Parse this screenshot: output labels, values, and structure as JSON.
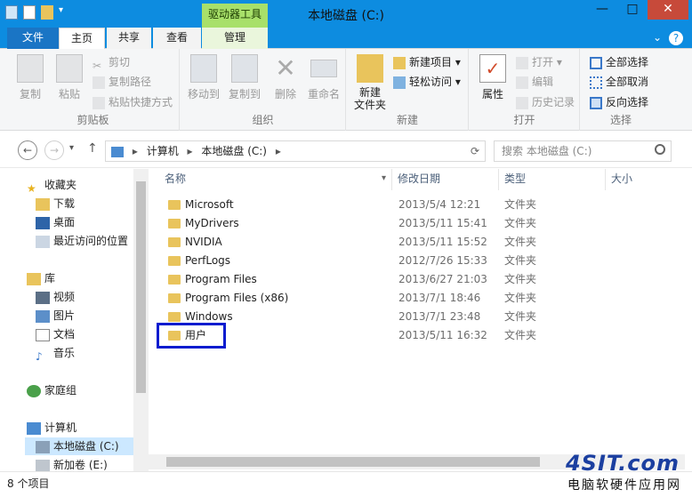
{
  "window": {
    "title": "本地磁盘 (C:)",
    "context_tool_label": "驱动器工具",
    "minimize": "—",
    "maximize": "□",
    "close": "✕"
  },
  "tabs": {
    "file": "文件",
    "home": "主页",
    "share": "共享",
    "view": "查看",
    "manage": "管理",
    "collapse": "⌄",
    "help": "?"
  },
  "ribbon": {
    "clipboard": {
      "label": "剪贴板",
      "copy": "复制",
      "paste": "粘贴",
      "cut": "剪切",
      "copy_path": "复制路径",
      "paste_shortcut": "粘贴快捷方式"
    },
    "organize": {
      "label": "组织",
      "move_to": "移动到",
      "copy_to": "复制到",
      "delete": "删除",
      "rename": "重命名"
    },
    "new": {
      "label": "新建",
      "new_folder": "新建\n文件夹",
      "new_item": "新建项目 ▾",
      "easy_access": "轻松访问 ▾"
    },
    "open": {
      "label": "打开",
      "properties": "属性",
      "open": "打开 ▾",
      "edit": "编辑",
      "history": "历史记录"
    },
    "select": {
      "label": "选择",
      "select_all": "全部选择",
      "select_none": "全部取消",
      "invert": "反向选择"
    }
  },
  "address": {
    "back": "←",
    "forward": "→",
    "recent": "▾",
    "up": "↑",
    "segments": [
      "计算机",
      "本地磁盘 (C:)"
    ],
    "sep": "▸",
    "refresh": "⟳",
    "search_placeholder": "搜索 本地磁盘 (C:)"
  },
  "nav": {
    "favorites": "收藏夹",
    "downloads": "下载",
    "desktop": "桌面",
    "recent": "最近访问的位置",
    "libraries": "库",
    "videos": "视频",
    "pictures": "图片",
    "documents": "文档",
    "music": "音乐",
    "homegroup": "家庭组",
    "computer": "计算机",
    "local_disk": "本地磁盘 (C:)",
    "new_volume": "新加卷 (E:)"
  },
  "columns": {
    "name": "名称",
    "modified": "修改日期",
    "type": "类型",
    "size": "大小"
  },
  "files": [
    {
      "name": "Microsoft",
      "date": "2013/5/4 12:21",
      "type": "文件夹"
    },
    {
      "name": "MyDrivers",
      "date": "2013/5/11 15:41",
      "type": "文件夹"
    },
    {
      "name": "NVIDIA",
      "date": "2013/5/11 15:52",
      "type": "文件夹"
    },
    {
      "name": "PerfLogs",
      "date": "2012/7/26 15:33",
      "type": "文件夹"
    },
    {
      "name": "Program Files",
      "date": "2013/6/27 21:03",
      "type": "文件夹"
    },
    {
      "name": "Program Files (x86)",
      "date": "2013/7/1 18:46",
      "type": "文件夹"
    },
    {
      "name": "Windows",
      "date": "2013/7/1 23:48",
      "type": "文件夹"
    },
    {
      "name": "用户",
      "date": "2013/5/11 16:32",
      "type": "文件夹"
    }
  ],
  "status": {
    "count": "8 个项目"
  },
  "watermark": {
    "logo": "4SIT.com",
    "text": "电脑软硬件应用网"
  },
  "colors": {
    "titlebar": "#0d8ce0",
    "context_tab": "#a8e06a",
    "highlight_box": "#0a1ccf",
    "folder": "#e9c45c"
  }
}
